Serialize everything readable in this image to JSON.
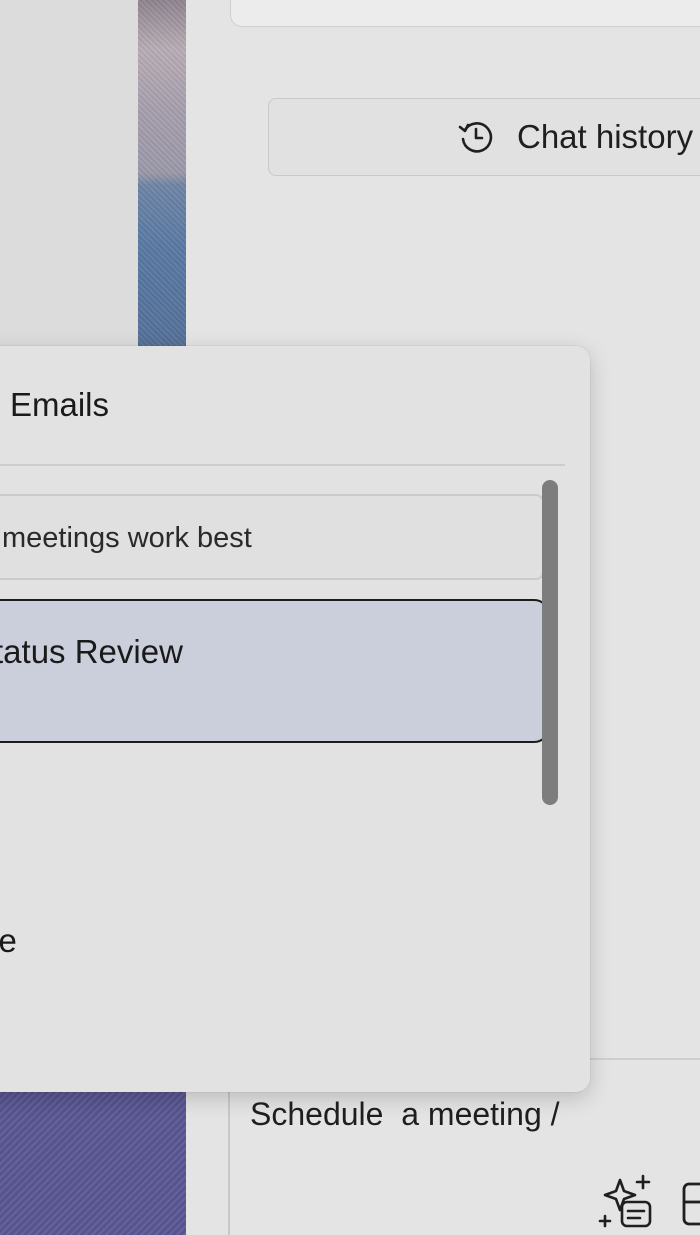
{
  "chat_history": {
    "label": "Chat history",
    "icon": "history-icon"
  },
  "popup": {
    "header": "Emails",
    "items": [
      {
        "label": "meetings work best",
        "selected": false
      },
      {
        "label": "tatus Review",
        "selected": true
      },
      {
        "label": "ce",
        "selected": false
      }
    ],
    "scrollbar_position": 0.0
  },
  "composer": {
    "text": "Schedule  a meeting /",
    "icons": [
      "sparkle-prompt-icon",
      "layout-icon"
    ]
  },
  "colors": {
    "selected_item_bg": "#cbcfdc",
    "selected_item_border": "#1c1c1c",
    "panel_bg": "#e4e4e4",
    "popup_bg": "#e2e2e2"
  }
}
